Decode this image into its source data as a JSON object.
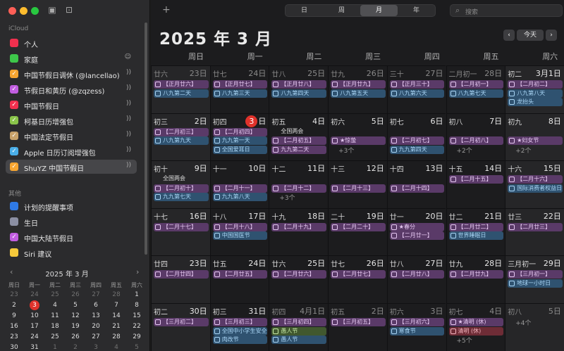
{
  "sidebar": {
    "icloud_label": "iCloud",
    "other_label": "其他",
    "icloud_items": [
      {
        "name": "个人",
        "color": "#f0304e",
        "checked": false,
        "trailing": ""
      },
      {
        "name": "家庭",
        "color": "#3ec74a",
        "checked": false,
        "trailing": "☺"
      },
      {
        "name": "中国节假日调休 (@lancellao)",
        "color": "#f7a531",
        "checked": true,
        "trailing": "))"
      },
      {
        "name": "节假日和黄历 (@zqzess)",
        "color": "#c15de0",
        "checked": true,
        "trailing": "))"
      },
      {
        "name": "中国节假日",
        "color": "#f0304e",
        "checked": true,
        "trailing": "))"
      },
      {
        "name": "柯基日历增强包",
        "color": "#8ac44a",
        "checked": true,
        "trailing": "))"
      },
      {
        "name": "中国法定节假日",
        "color": "#c8a26a",
        "checked": true,
        "trailing": "))"
      },
      {
        "name": "Apple 日历订阅增强包",
        "color": "#4aaee8",
        "checked": true,
        "trailing": "))"
      },
      {
        "name": "ShuYZ 中国节假日",
        "color": "#f7a531",
        "checked": true,
        "trailing": "))"
      }
    ],
    "other_items": [
      {
        "name": "计划的提醒事项",
        "color": "#2f7ae5",
        "checked": false,
        "trailing": ""
      },
      {
        "name": "生日",
        "color": "#8b8fa3",
        "checked": false,
        "trailing": ""
      },
      {
        "name": "中国大陆节假日",
        "color": "#c15de0",
        "checked": true,
        "trailing": ""
      },
      {
        "name": "Siri 建议",
        "color": "#f5c93b",
        "checked": false,
        "trailing": ""
      }
    ]
  },
  "mini_calendar": {
    "title": "2025 年 3 月",
    "prev": "‹",
    "next": "›",
    "weekdays": [
      "周日",
      "周一",
      "周二",
      "周三",
      "周四",
      "周五",
      "周六"
    ],
    "weeks": [
      [
        "23",
        "24",
        "25",
        "26",
        "27",
        "28",
        "1"
      ],
      [
        "2",
        "3",
        "4",
        "5",
        "6",
        "7",
        "8"
      ],
      [
        "9",
        "10",
        "11",
        "12",
        "13",
        "14",
        "15"
      ],
      [
        "16",
        "17",
        "18",
        "19",
        "20",
        "21",
        "22"
      ],
      [
        "23",
        "24",
        "25",
        "26",
        "27",
        "28",
        "29"
      ],
      [
        "30",
        "31",
        "1",
        "2",
        "3",
        "4",
        "5"
      ]
    ]
  },
  "toolbar": {
    "add": "+",
    "views": [
      "日",
      "周",
      "月",
      "年"
    ],
    "active_view": "月",
    "search_placeholder": "搜索"
  },
  "header": {
    "title": "2025 年 3 月",
    "prev": "‹",
    "today": "今天",
    "next": "›"
  },
  "weekdays": [
    "周日",
    "周一",
    "周二",
    "周三",
    "周四",
    "周五",
    "周六"
  ],
  "month": [
    [
      {
        "l": "廿六",
        "d": "23日",
        "om": true,
        "ev": [
          [
            "p",
            "【正月廿六】"
          ],
          [
            "b",
            "八九第二天"
          ]
        ]
      },
      {
        "l": "廿七",
        "d": "24日",
        "om": true,
        "ev": [
          [
            "p",
            "【正月廿七】"
          ],
          [
            "b",
            "八九第三天"
          ]
        ]
      },
      {
        "l": "廿八",
        "d": "25日",
        "om": true,
        "ev": [
          [
            "p",
            "【正月廿八】"
          ],
          [
            "b",
            "八九第四天"
          ]
        ]
      },
      {
        "l": "廿九",
        "d": "26日",
        "om": true,
        "ev": [
          [
            "p",
            "【正月廿九】"
          ],
          [
            "b",
            "八九第五天"
          ]
        ]
      },
      {
        "l": "三十",
        "d": "27日",
        "om": true,
        "ev": [
          [
            "p",
            "【正月三十】"
          ],
          [
            "b",
            "八九第六天"
          ]
        ]
      },
      {
        "l": "二月初一",
        "d": "28日",
        "om": true,
        "ev": [
          [
            "p",
            "【二月初一】"
          ],
          [
            "b",
            "八九第七天"
          ]
        ]
      },
      {
        "l": "初二",
        "d": "3月1日",
        "om": false,
        "ev": [
          [
            "p",
            "【二月初二】"
          ],
          [
            "b",
            "八九第八天"
          ],
          [
            "b",
            "龙抬头"
          ]
        ]
      }
    ],
    [
      {
        "l": "初三",
        "d": "2日",
        "ev": [
          [
            "p",
            "【二月初三】"
          ],
          [
            "b",
            "八九第九天"
          ]
        ]
      },
      {
        "l": "初四",
        "d": "3",
        "today": true,
        "ev": [
          [
            "p",
            "【二月初四】"
          ],
          [
            "b",
            "九九第一天"
          ],
          [
            "b",
            "全国爱耳日"
          ]
        ]
      },
      {
        "l": "初五",
        "d": "4日",
        "ev": [
          [
            "p",
            "【二月初五】"
          ],
          [
            "p",
            "九九第二天"
          ]
        ]
      },
      {
        "l": "初六",
        "d": "5日",
        "ev": [
          [
            "p",
            "★惊蛰"
          ]
        ],
        "more": "+3个"
      },
      {
        "l": "初七",
        "d": "6日",
        "ev": [
          [
            "p",
            "【二月初七】"
          ],
          [
            "b",
            "九九第四天"
          ]
        ]
      },
      {
        "l": "初八",
        "d": "7日",
        "ev": [
          [
            "p",
            "【二月初八】"
          ]
        ],
        "more": "+2个"
      },
      {
        "l": "初九",
        "d": "8日",
        "ev": [
          [
            "p",
            "★妇女节"
          ]
        ],
        "more": "+2个"
      }
    ],
    [
      {
        "l": "初十",
        "d": "9日",
        "ev": [
          [
            "p",
            "【二月初十】"
          ],
          [
            "b",
            "九九第七天"
          ]
        ]
      },
      {
        "l": "十一",
        "d": "10日",
        "ev": [
          [
            "p",
            "【二月十一】"
          ],
          [
            "b",
            "九九第八天"
          ]
        ]
      },
      {
        "l": "十二",
        "d": "11日",
        "ev": [
          [
            "p",
            "【二月十二】"
          ]
        ],
        "more": "+3个"
      },
      {
        "l": "十三",
        "d": "12日",
        "ev": [
          [
            "p",
            "【二月十三】"
          ]
        ]
      },
      {
        "l": "十四",
        "d": "13日",
        "ev": [
          [
            "p",
            "【二月十四】"
          ]
        ]
      },
      {
        "l": "十五",
        "d": "14日",
        "ev": [
          [
            "p",
            "【二月十五】"
          ]
        ]
      },
      {
        "l": "十六",
        "d": "15日",
        "ev": [
          [
            "p",
            "【二月十六】"
          ],
          [
            "b",
            "国际消费者权益日"
          ]
        ]
      }
    ],
    [
      {
        "l": "十七",
        "d": "16日",
        "ev": [
          [
            "p",
            "【二月十七】"
          ]
        ]
      },
      {
        "l": "十八",
        "d": "17日",
        "ev": [
          [
            "p",
            "【二月十八】"
          ],
          [
            "b",
            "中国国医节"
          ]
        ]
      },
      {
        "l": "十九",
        "d": "18日",
        "ev": [
          [
            "p",
            "【二月十九】"
          ]
        ]
      },
      {
        "l": "二十",
        "d": "19日",
        "ev": [
          [
            "p",
            "【二月二十】"
          ]
        ]
      },
      {
        "l": "廿一",
        "d": "20日",
        "ev": [
          [
            "p",
            "★春分"
          ],
          [
            "p",
            "【二月廿一】"
          ]
        ]
      },
      {
        "l": "廿二",
        "d": "21日",
        "ev": [
          [
            "p",
            "【二月廿二】"
          ],
          [
            "b",
            "世界睡眠日"
          ]
        ]
      },
      {
        "l": "廿三",
        "d": "22日",
        "ev": [
          [
            "p",
            "【二月廿三】"
          ]
        ]
      }
    ],
    [
      {
        "l": "廿四",
        "d": "23日",
        "ev": [
          [
            "p",
            "【二月廿四】"
          ]
        ]
      },
      {
        "l": "廿五",
        "d": "24日",
        "ev": [
          [
            "p",
            "【二月廿五】"
          ]
        ]
      },
      {
        "l": "廿六",
        "d": "25日",
        "ev": [
          [
            "p",
            "【二月廿六】"
          ]
        ]
      },
      {
        "l": "廿七",
        "d": "26日",
        "ev": [
          [
            "p",
            "【二月廿七】"
          ]
        ]
      },
      {
        "l": "廿八",
        "d": "27日",
        "ev": [
          [
            "p",
            "【二月廿八】"
          ]
        ]
      },
      {
        "l": "廿九",
        "d": "28日",
        "ev": [
          [
            "p",
            "【二月廿九】"
          ]
        ]
      },
      {
        "l": "三月初一",
        "d": "29日",
        "ev": [
          [
            "p",
            "【三月初一】"
          ],
          [
            "b",
            "地球一小时日"
          ]
        ]
      }
    ],
    [
      {
        "l": "初二",
        "d": "30日",
        "ev": [
          [
            "p",
            "【三月初二】"
          ]
        ]
      },
      {
        "l": "初三",
        "d": "31日",
        "ev": [
          [
            "p",
            "【三月初三】"
          ],
          [
            "b",
            "全国中小学生安全教育日"
          ],
          [
            "b",
            "肉改节"
          ]
        ]
      },
      {
        "l": "初四",
        "d": "4月1日",
        "om": true,
        "ev": [
          [
            "p",
            "【三月初四】"
          ],
          [
            "g",
            "愚人节"
          ],
          [
            "b",
            "愚人节"
          ]
        ]
      },
      {
        "l": "初五",
        "d": "2日",
        "om": true,
        "ev": [
          [
            "p",
            "【三月初五】"
          ]
        ]
      },
      {
        "l": "初六",
        "d": "3日",
        "om": true,
        "ev": [
          [
            "p",
            "【三月初六】"
          ],
          [
            "b",
            "寒食节"
          ]
        ]
      },
      {
        "l": "初七",
        "d": "4日",
        "om": true,
        "ev": [
          [
            "p",
            "★清明 (休)"
          ],
          [
            "r",
            "清明 (休)"
          ]
        ],
        "more": "+5个"
      },
      {
        "l": "初八",
        "d": "5日",
        "om": true,
        "ev": [],
        "more": "+4个"
      }
    ]
  ],
  "spans": {
    "lianghui_1": "全国两会",
    "lianghui_2": "全国两会"
  }
}
